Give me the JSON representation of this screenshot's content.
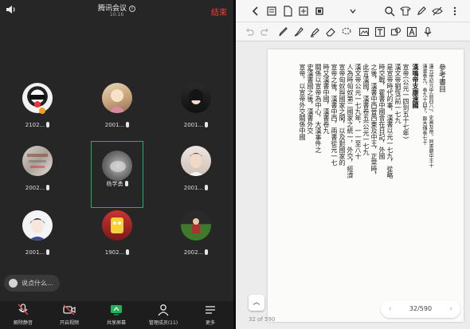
{
  "meeting": {
    "title": "腾讯会议",
    "time": "10:16",
    "end_label": "结束",
    "participants": [
      {
        "name": "2102...",
        "mic": "on"
      },
      {
        "name": "2001...",
        "mic": "on"
      },
      {
        "name": "2001...",
        "mic": "on"
      },
      {
        "name": "2002...",
        "mic": "on"
      },
      {
        "name": "杨学勇",
        "mic": "on"
      },
      {
        "name": "2001...",
        "mic": "on"
      },
      {
        "name": "2001...",
        "mic": "on"
      },
      {
        "name": "1902...",
        "mic": "on"
      },
      {
        "name": "2002...",
        "mic": "on"
      }
    ],
    "say_placeholder": "说点什么...",
    "toolbar": [
      {
        "label": "解除静音",
        "icon": "mic-muted-icon"
      },
      {
        "label": "开启视频",
        "icon": "camera-off-icon"
      },
      {
        "label": "共享屏幕",
        "icon": "share-screen-icon"
      },
      {
        "label": "管理成员(11)",
        "icon": "members-icon"
      },
      {
        "label": "更多",
        "icon": "more-icon"
      }
    ],
    "colors": {
      "accent_green": "#21b35b",
      "end_red": "#ff3b30"
    }
  },
  "reader": {
    "page_current": "32",
    "page_total": "590",
    "page_indicator": "32/590",
    "page_footer": "32 of 590",
    "doc_columns": [
      "參考書目",
      "漢鳴帝支康遠國",
      "漢元帝初元中(前四八)，史高及帝，同書朝中王十",
      "漢書卷九、卷九十四下，鄭吉傳卷七十",
      "宣帝(公元一四到五十七年)",
      "漢文帝劉恆(前一七九",
      "是宣帝時代的事，漢書以元一七九，從略",
      "時交戰，霍書中國會在日記，外國",
      "之後，漢書中西晉西東及中王，正常時，",
      "此言漢國，漢書卷五(公元一七九",
      "漢文帝公元一七九年，一一至八十",
      "人為時匈奴第二國家之統一，外交，經濟",
      "宣帝匈奴與國家之間，以及對國家的",
      "宣帝之後，漢書中西，兩書從元一七",
      "時又漢書中國，漢書卷九",
      "關係以宣帝為中心，大漢事件之",
      "史漢書國之後，漢書外交",
      "宣帝，以宣帝外交關係中國"
    ]
  }
}
